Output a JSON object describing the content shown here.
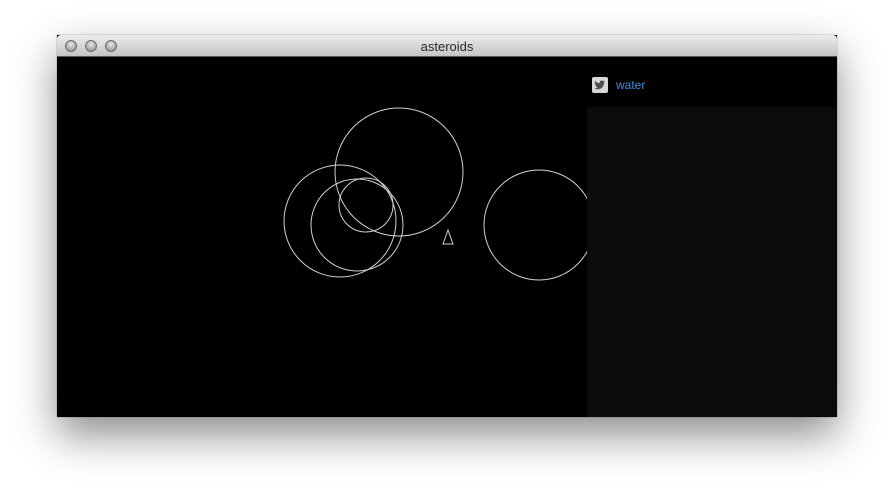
{
  "window": {
    "title": "asteroids"
  },
  "panel": {
    "search_term": "water",
    "icon": "twitter-icon",
    "link_color": "#3b8fe0"
  },
  "colors": {
    "game_background": "#000000",
    "asteroid_stroke": "#d0d0d0",
    "panel_body": "#0b0b0b"
  }
}
